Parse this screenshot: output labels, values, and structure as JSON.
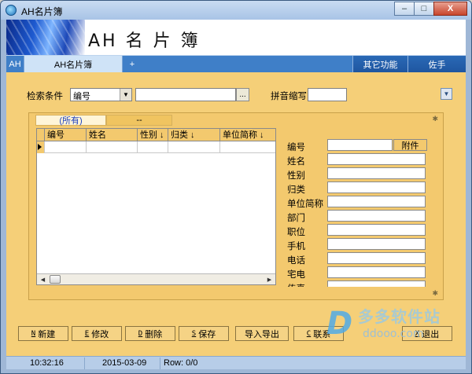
{
  "window": {
    "title": "AH名片簿",
    "minimize": "–",
    "maximize": "□",
    "close": "X"
  },
  "banner": {
    "title": "AH 名 片 簿"
  },
  "tabs": {
    "home": "AH",
    "active": "AH名片簿",
    "add": "+",
    "right": [
      "其它功能",
      "佐手"
    ]
  },
  "search": {
    "label": "检索条件",
    "field_value": "编号",
    "query_value": "",
    "ellipsis": "...",
    "pinyin_label": "拼音缩写",
    "pinyin_value": ""
  },
  "categories": {
    "active": "(所有)",
    "inactive": "--"
  },
  "grid": {
    "columns": [
      "编号",
      "姓名",
      "性别 ↓",
      "归类 ↓",
      "单位简称 ↓"
    ],
    "rows": []
  },
  "form": {
    "attach_button": "附件",
    "fields": [
      {
        "label": "编号",
        "value": ""
      },
      {
        "label": "姓名",
        "value": ""
      },
      {
        "label": "性别",
        "value": ""
      },
      {
        "label": "归类",
        "value": ""
      },
      {
        "label": "单位简称",
        "value": ""
      },
      {
        "label": "部门",
        "value": ""
      },
      {
        "label": "职位",
        "value": ""
      },
      {
        "label": "手机",
        "value": ""
      },
      {
        "label": "电话",
        "value": ""
      },
      {
        "label": "宅电",
        "value": ""
      },
      {
        "label": "传真",
        "value": ""
      }
    ]
  },
  "toolbar": {
    "buttons": [
      {
        "hotkey": "N",
        "label": "新建"
      },
      {
        "hotkey": "E",
        "label": "修改"
      },
      {
        "hotkey": "D",
        "label": "删除"
      },
      {
        "hotkey": "S",
        "label": "保存"
      },
      {
        "hotkey": "",
        "label": "导入导出"
      },
      {
        "hotkey": "C",
        "label": "联系"
      },
      {
        "hotkey": "X",
        "label": "退出"
      }
    ]
  },
  "watermark": {
    "logo": "D",
    "text": "多多软件站",
    "url": "ddooo.com"
  },
  "status": {
    "time": "10:32:16",
    "date": "2015-03-09",
    "row": "Row: 0/0"
  }
}
